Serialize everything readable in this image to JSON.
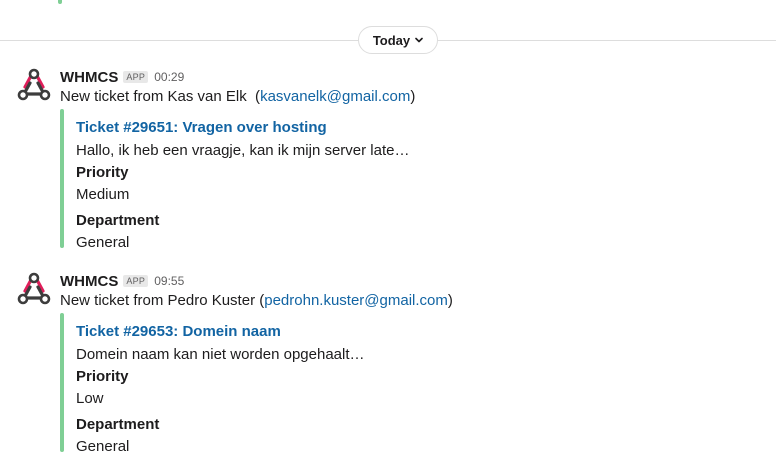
{
  "day_divider": {
    "label": "Today"
  },
  "colors": {
    "attachment_bar": "#7fcf95",
    "link": "#1264a3",
    "app_icon": "#e01e5a"
  },
  "messages": [
    {
      "sender": "WHMCS",
      "badge": "APP",
      "time": "00:29",
      "text_prefix": "New ticket from Kas van Elk  (",
      "email": "kasvanelk@gmail.com",
      "text_suffix": ")",
      "attachment": {
        "title": "Ticket #29651: Vragen over hosting",
        "text": "Hallo, ik heb een vraagje, kan ik mijn server late…",
        "fields": [
          {
            "label": "Priority",
            "value": "Medium"
          },
          {
            "label": "Department",
            "value": "General"
          }
        ]
      }
    },
    {
      "sender": "WHMCS",
      "badge": "APP",
      "time": "09:55",
      "text_prefix": "New ticket from Pedro Kuster (",
      "email": "pedrohn.kuster@gmail.com",
      "text_suffix": ")",
      "attachment": {
        "title": "Ticket #29653: Domein naam",
        "text": "Domein naam kan niet worden opgehaalt…",
        "fields": [
          {
            "label": "Priority",
            "value": "Low"
          },
          {
            "label": "Department",
            "value": "General"
          }
        ]
      }
    }
  ]
}
